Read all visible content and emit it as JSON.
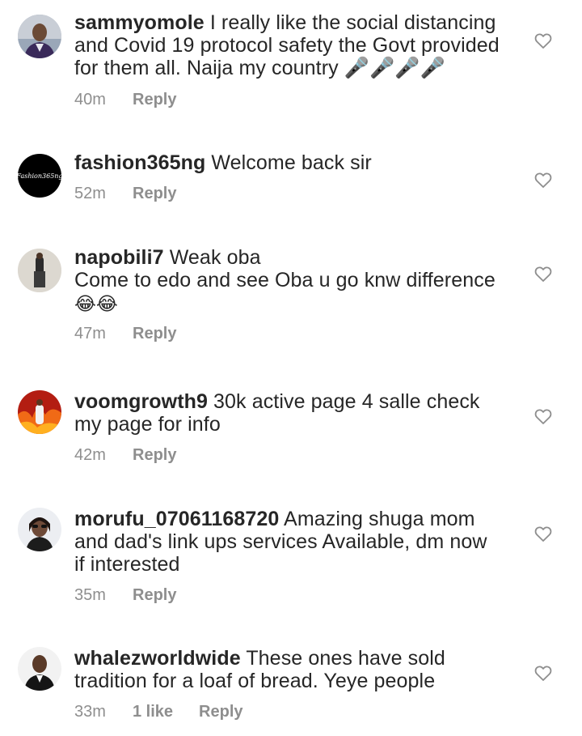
{
  "comments": [
    {
      "username": "sammyomole",
      "text": "I really like the social distancing and Covid 19 protocol safety the Govt provided for them all. Naija my country 🎤🎤🎤🎤",
      "emoji_line": "",
      "time": "40m",
      "likes": "",
      "reply": "Reply",
      "avatar": "man-in-suit-avatar"
    },
    {
      "username": "fashion365ng",
      "text": "Welcome back sir",
      "emoji_line": "",
      "time": "52m",
      "likes": "",
      "reply": "Reply",
      "avatar": "black-script-logo-avatar",
      "avatar_text": "Fashion365ng"
    },
    {
      "username": "napobili7",
      "text": "Weak oba\nCome to edo and see Oba u go knw difference",
      "emoji_line": "😂😂",
      "time": "47m",
      "likes": "",
      "reply": "Reply",
      "avatar": "standing-man-avatar"
    },
    {
      "username": "voomgrowth9",
      "text": "30k active page 4 salle check my page for info",
      "emoji_line": "",
      "time": "42m",
      "likes": "",
      "reply": "Reply",
      "avatar": "red-fire-avatar"
    },
    {
      "username": "morufu_07061168720",
      "text": "Amazing shuga mom and dad's link ups services Available, dm now if interested",
      "emoji_line": "",
      "time": "35m",
      "likes": "",
      "reply": "Reply",
      "avatar": "woman-sunglasses-avatar"
    },
    {
      "username": "whalezworldwide",
      "text": "These ones have sold tradition for a loaf of bread. Yeye people",
      "emoji_line": "",
      "time": "33m",
      "likes": "1 like",
      "reply": "Reply",
      "avatar": "bald-man-avatar"
    }
  ],
  "colors": {
    "text": "#262626",
    "meta": "#8e8e8e",
    "heart_stroke": "#8e8e8e"
  }
}
